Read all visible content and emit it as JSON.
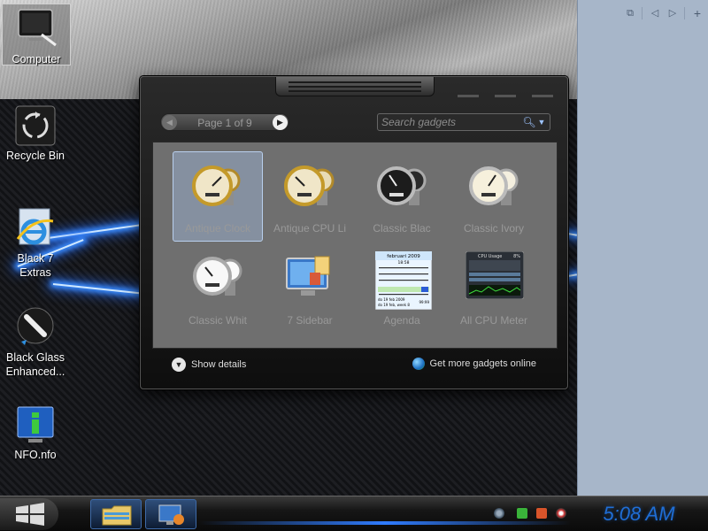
{
  "desktop": {
    "icons": [
      {
        "label": "Computer",
        "icon": "computer-icon"
      },
      {
        "label": "Recycle Bin",
        "icon": "recycle-bin-icon"
      },
      {
        "label": "Black 7 Extras",
        "icon": "internet-explorer-icon"
      },
      {
        "label": "Black Glass Enhanced...",
        "icon": "brush-icon"
      },
      {
        "label": "NFO.nfo",
        "icon": "info-icon"
      }
    ]
  },
  "gallery": {
    "pager_text": "Page 1 of 9",
    "search_placeholder": "Search gadgets",
    "gadgets": [
      {
        "name": "Antique Clock",
        "icon": "antique-gauge-icon"
      },
      {
        "name": "Antique CPU Li",
        "icon": "antique-gauge-icon"
      },
      {
        "name": "Classic Blac",
        "icon": "classic-black-gauge-icon"
      },
      {
        "name": "Classic Ivory",
        "icon": "classic-ivory-gauge-icon"
      },
      {
        "name": "Classic Whit",
        "icon": "classic-white-gauge-icon"
      },
      {
        "name": "7 Sidebar",
        "icon": "monitor-sidebar-icon"
      },
      {
        "name": "Agenda",
        "icon": "calendar-icon"
      },
      {
        "name": "All CPU Meter",
        "icon": "cpu-meter-icon"
      }
    ],
    "calendar_thumb": {
      "month": "februari 2009",
      "time": "18:58",
      "footer_left": "do 19 feb 2009",
      "footer_left2": "do 19 feb, week 8",
      "footer_right": "99:99"
    },
    "cpu_thumb": {
      "title": "CPU Usage",
      "value": "8%"
    },
    "show_details": "Show details",
    "get_more": "Get more gadgets online"
  },
  "taskbar": {
    "clock": "5:08 AM"
  },
  "colors": {
    "clock": "#1f6ed6",
    "selection": "#b9d0ee",
    "side_pane": "#a7b6c9"
  }
}
